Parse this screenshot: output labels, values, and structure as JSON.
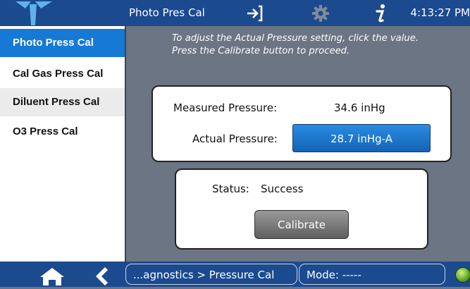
{
  "header": {
    "title": "Photo Pres Cal",
    "time": "4:13:27 PM",
    "icons": [
      "teledyne-logo",
      "exit-icon",
      "gear-icon",
      "info-icon"
    ]
  },
  "sidebar": {
    "items": [
      {
        "label": "Photo Press Cal",
        "active": true
      },
      {
        "label": "Cal Gas Press Cal",
        "active": false
      },
      {
        "label": "Diluent Press Cal",
        "active": false
      },
      {
        "label": "O3 Press Cal",
        "active": false
      }
    ]
  },
  "main": {
    "instructions": [
      "To adjust the Actual Pressure setting, click the value.",
      "Press the Calibrate button to proceed."
    ],
    "measured_label": "Measured Pressure:",
    "measured_value": "34.6 inHg",
    "actual_label": "Actual Pressure:",
    "actual_value": "28.7 inHg-A",
    "status_label": "Status:",
    "status_value": "Success",
    "calibrate_label": "Calibrate"
  },
  "footer": {
    "breadcrumb": "...agnostics > Pressure Cal",
    "mode": "Mode: -----",
    "icons": [
      "home-icon",
      "back-icon",
      "status-led"
    ]
  },
  "colors": {
    "header_bg": "#1c4a8f",
    "content_bg": "#6b7583",
    "active_item": "#1679d6",
    "value_button": "#1a72c9"
  }
}
